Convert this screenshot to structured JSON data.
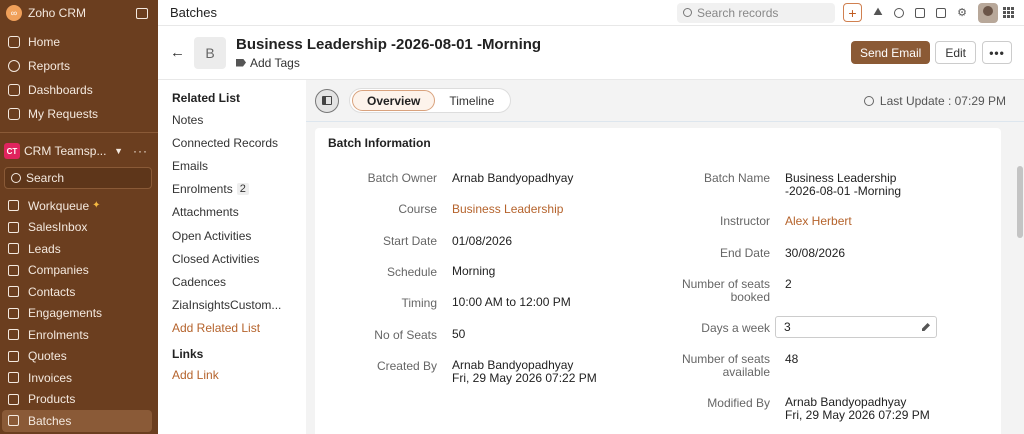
{
  "sidebar": {
    "brand": "Zoho CRM",
    "nav": [
      "Home",
      "Reports",
      "Dashboards",
      "My Requests"
    ],
    "team": {
      "badge": "CT",
      "name": "CRM Teamsp..."
    },
    "search_placeholder": "Search",
    "modules": [
      "Workqueue",
      "SalesInbox",
      "Leads",
      "Companies",
      "Contacts",
      "Engagements",
      "Enrolments",
      "Quotes",
      "Invoices",
      "Products",
      "Batches"
    ],
    "active_module": "Batches"
  },
  "topbar": {
    "title": "Batches",
    "search_placeholder": "Search records",
    "plus": "+"
  },
  "record": {
    "avatar_letter": "B",
    "title": "Business Leadership -2026-08-01 -Morning",
    "add_tags": "Add Tags",
    "send_email": "Send Email",
    "edit": "Edit",
    "more": "•••"
  },
  "related": {
    "header": "Related List",
    "items": [
      "Notes",
      "Connected Records",
      "Emails",
      "Enrolments",
      "Attachments",
      "Open Activities",
      "Closed Activities",
      "Cadences",
      "ZiaInsightsCustom..."
    ],
    "enrolments_count": "2",
    "add_related": "Add Related List",
    "links_header": "Links",
    "add_link": "Add Link"
  },
  "tabs": {
    "overview": "Overview",
    "timeline": "Timeline",
    "last_update": "Last Update : 07:29 PM"
  },
  "batch": {
    "section_title": "Batch Information",
    "left": {
      "owner_label": "Batch Owner",
      "owner": "Arnab Bandyopadhyay",
      "course_label": "Course",
      "course": "Business Leadership",
      "start_label": "Start Date",
      "start": "01/08/2026",
      "schedule_label": "Schedule",
      "schedule": "Morning",
      "timing_label": "Timing",
      "timing": "10:00 AM to 12:00 PM",
      "seats_label": "No of Seats",
      "seats": "50",
      "created_label": "Created By",
      "created_by": "Arnab Bandyopadhyay",
      "created_at": "Fri, 29 May 2026 07:22 PM"
    },
    "right": {
      "name_label": "Batch Name",
      "name_line1": "Business Leadership",
      "name_line2": "-2026-08-01 -Morning",
      "instructor_label": "Instructor",
      "instructor": "Alex Herbert",
      "end_label": "End Date",
      "end": "30/08/2026",
      "booked_label1": "Number of seats",
      "booked_label2": "booked",
      "booked": "2",
      "days_label": "Days a week",
      "days": "3",
      "avail_label1": "Number of seats",
      "avail_label2": "available",
      "avail": "48",
      "modified_label": "Modified By",
      "modified_by": "Arnab Bandyopadhyay",
      "modified_at": "Fri, 29 May 2026 07:29 PM"
    }
  }
}
